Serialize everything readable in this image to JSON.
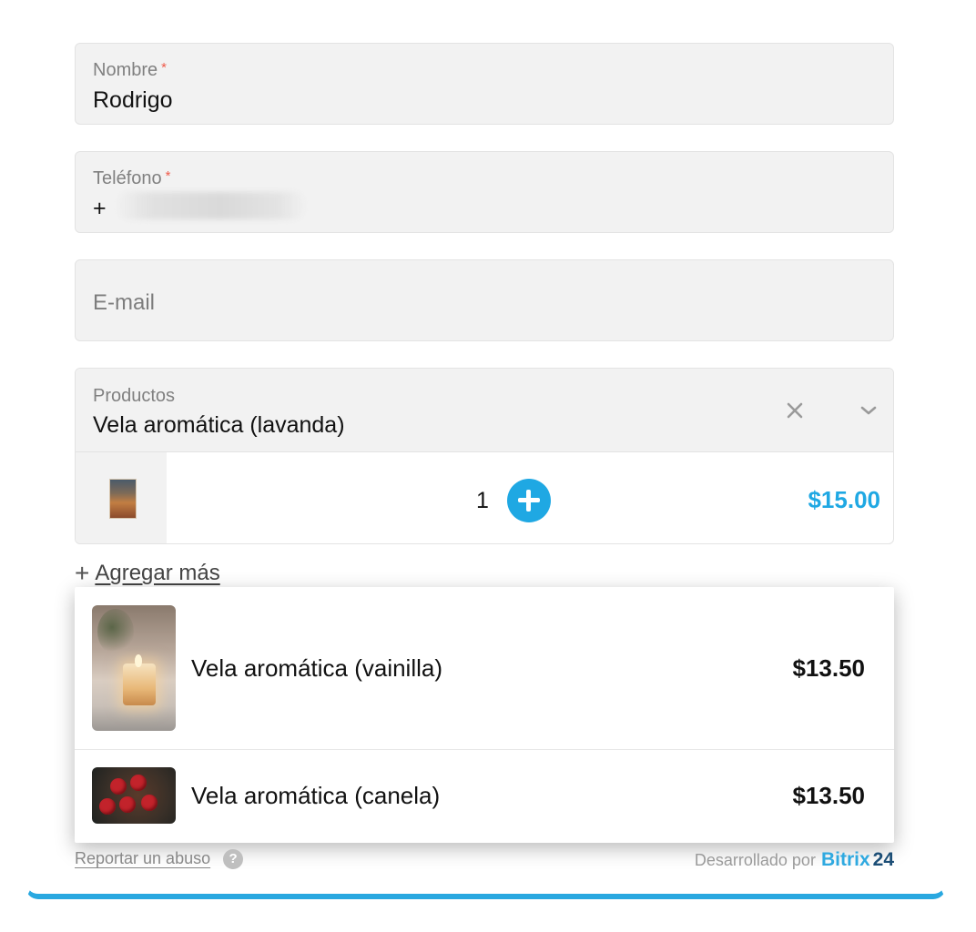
{
  "form": {
    "name_label": "Nombre",
    "name_required": "*",
    "name_value": "Rodrigo",
    "phone_label": "Teléfono",
    "phone_required": "*",
    "phone_value": "+",
    "email_placeholder": "E-mail",
    "products_label": "Productos",
    "products_value": "Vela aromática (lavanda)"
  },
  "cart_item": {
    "quantity": "1",
    "price": "$15.00"
  },
  "add_more": {
    "plus": "+",
    "label": "Agregar más"
  },
  "dropdown": {
    "options": [
      {
        "name": "Vela aromática (vainilla)",
        "price": "$13.50"
      },
      {
        "name": "Vela aromática (canela)",
        "price": "$13.50"
      }
    ]
  },
  "footer": {
    "report_label": "Reportar un abuso",
    "help_glyph": "?",
    "powered_prefix": "Desarrollado por",
    "brand": "Bitrix",
    "brand_number": "24"
  },
  "colors": {
    "accent": "#1fa8e3",
    "required": "#ef5b4b",
    "field_bg": "#f2f2f2"
  }
}
